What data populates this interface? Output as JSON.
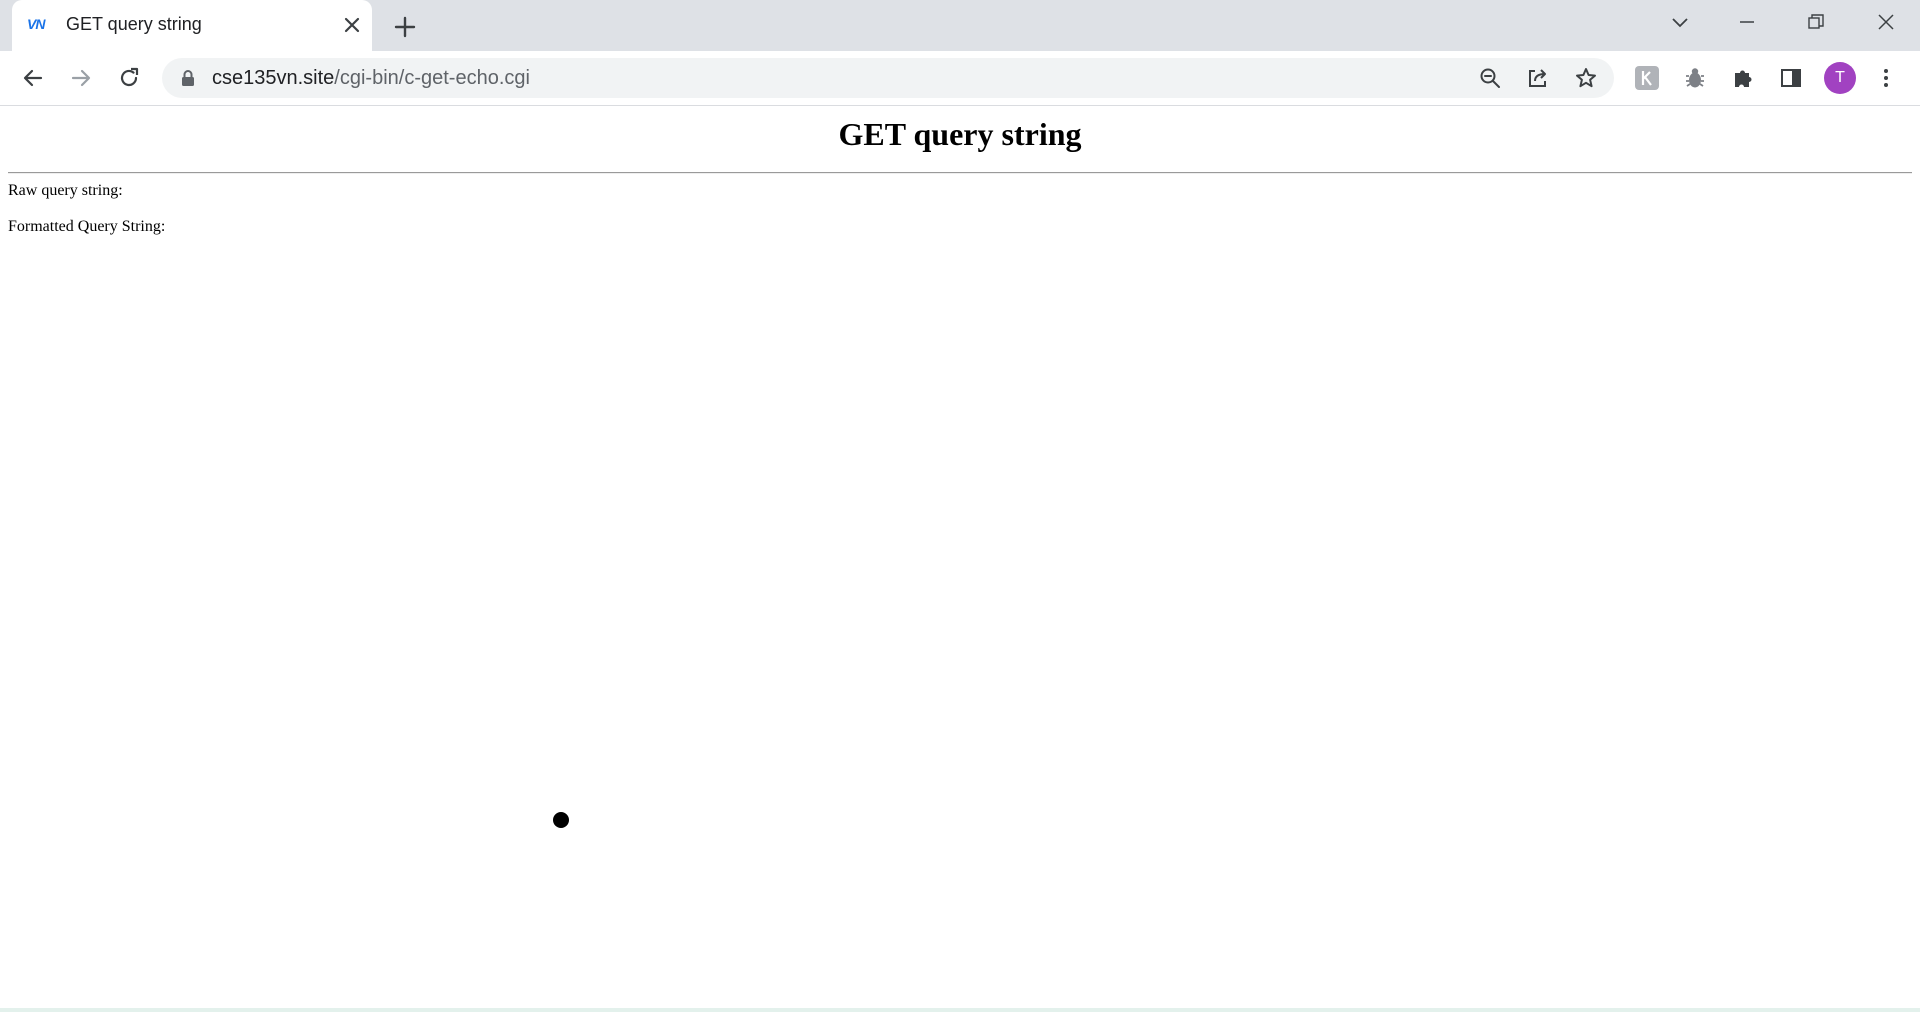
{
  "tab": {
    "favicon_text": "VN",
    "title": "GET query string"
  },
  "address_bar": {
    "host": "cse135vn.site",
    "path": "/cgi-bin/c-get-echo.cgi"
  },
  "profile": {
    "initial": "T",
    "color": "#a142c1"
  },
  "icons": {
    "tab_close": "close-icon",
    "new_tab": "plus-icon",
    "tab_search": "chevron-down-icon",
    "minimize": "minimize-icon",
    "restore": "restore-icon",
    "close_window": "close-icon",
    "back": "arrow-left-icon",
    "forward": "arrow-right-icon",
    "reload": "reload-icon",
    "lock": "lock-icon",
    "zoom": "zoom-out-icon",
    "share": "share-icon",
    "bookmark": "star-icon",
    "extension_1": "extension-k-icon",
    "extension_2": "bug-icon",
    "extensions": "puzzle-icon",
    "side_panel": "side-panel-icon",
    "menu": "more-vert-icon"
  },
  "page": {
    "heading": "GET query string",
    "raw_label": "Raw query string:",
    "formatted_label": "Formatted Query String:"
  }
}
